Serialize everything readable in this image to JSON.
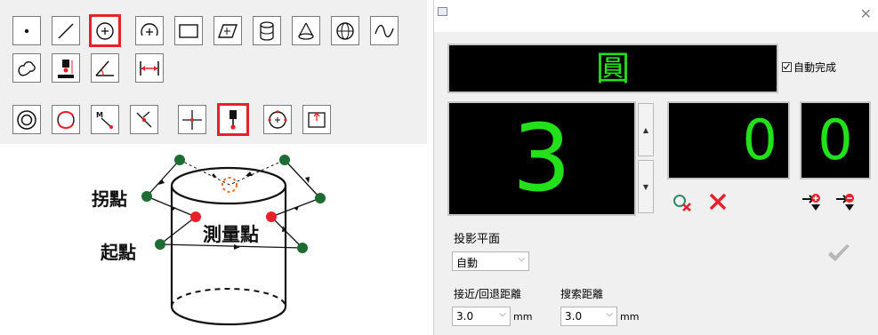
{
  "toolbar": {
    "rows": [
      [
        "point",
        "line",
        "circle",
        "arc",
        "rectangle",
        "plane",
        "cylinder",
        "cone",
        "sphere",
        "curve"
      ],
      [
        "free-shape",
        "probe-depth",
        "angle",
        "distance"
      ],
      [
        "ring",
        "rotate",
        "manual-move",
        "path",
        "crosshair",
        "probe-tip",
        "circle-target",
        "frame"
      ]
    ]
  },
  "diagram": {
    "inflection_label": "拐點",
    "start_label": "起點",
    "measure_label": "測量點"
  },
  "dialog": {
    "feature_name": "圓",
    "auto_complete_label": "自動完成",
    "auto_complete_checked": true,
    "point_count": "3",
    "counter_a": "0",
    "counter_b": "0",
    "projection_label": "投影平面",
    "projection_value": "自動",
    "approach_label": "接近/回退距離",
    "approach_value": "3.0",
    "approach_unit": "mm",
    "search_label": "搜索距離",
    "search_value": "3.0",
    "search_unit": "mm",
    "colors": {
      "digit": "#22e01a",
      "panel": "#000000",
      "highlight": "#e8202a"
    }
  }
}
